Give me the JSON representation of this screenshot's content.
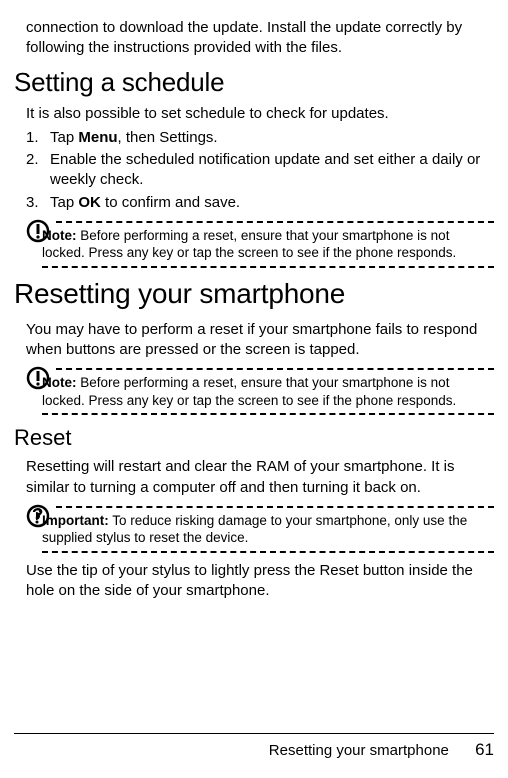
{
  "intro_para": "connection to download the update. Install the update cor­rectly by following the instructions provided with the files.",
  "h_schedule": "Setting a schedule",
  "schedule_para": "It is also possible to set schedule to check for updates.",
  "steps": [
    {
      "n": "1.",
      "pre": "Tap ",
      "b": "Menu",
      "post": ", then Settings."
    },
    {
      "n": "2.",
      "pre": "",
      "b": "",
      "post": "Enable the scheduled notification update and set either a daily or weekly check."
    },
    {
      "n": "3.",
      "pre": "Tap ",
      "b": "OK",
      "post": " to confirm and save."
    }
  ],
  "note_label": "Note:",
  "note1_text": " Before performing a reset, ensure that your smartphone is not locked. Press any key or tap the screen to see if the phone responds.",
  "h_chapter": "Resetting your smartphone",
  "chapter_para": "You may have to perform a reset if your smartphone fails to respond when buttons are pressed or the screen is tapped.",
  "note2_text": " Before performing a reset, ensure that your smartphone is not locked. Press any key or tap the screen to see if the phone responds.",
  "h_reset": "Reset",
  "reset_para": "Resetting will restart and clear the RAM of your smartphone. It is similar to turning a computer off and then turning it back on.",
  "important_label": "Important:",
  "important_text": " To reduce risking damage to your smartphone, only use the supplied stylus to reset the device.",
  "stylus_para": "Use the tip of your stylus to lightly press the Reset button inside the hole on the side of your smartphone.",
  "footer_title": "Resetting your smartphone",
  "page_num": "61"
}
